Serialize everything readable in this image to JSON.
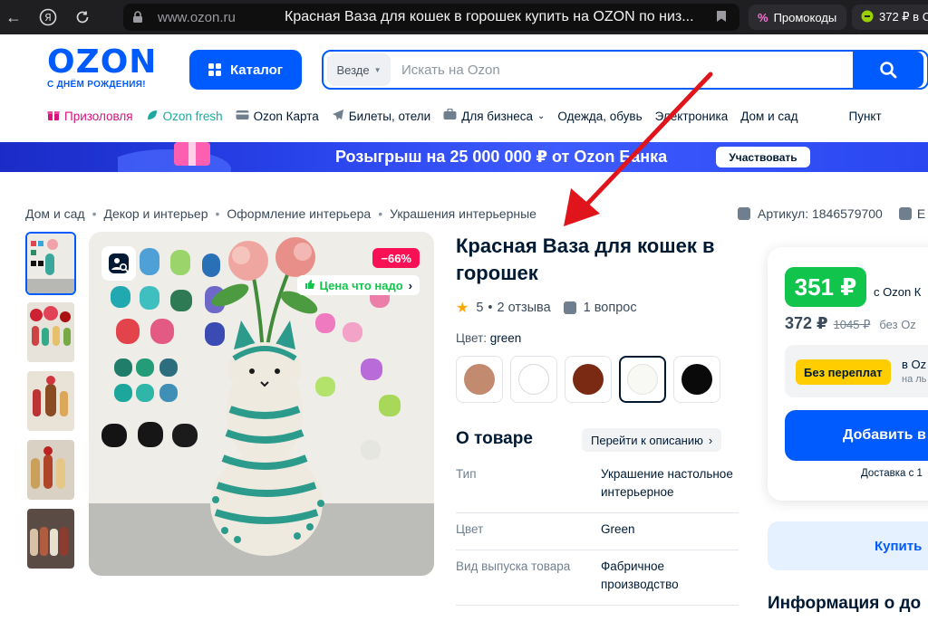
{
  "browser": {
    "domain": "www.ozon.ru",
    "tab_title": "Красная Ваза для кошек в горошек купить на OZON по низ...",
    "promo_chip": "Промокоды",
    "balance_chip": "372 ₽ в Ст",
    "icons": [
      "back-arrow-icon",
      "yandex-icon",
      "reload-icon",
      "lock-icon",
      "bookmark-icon"
    ]
  },
  "header": {
    "logo": "OZON",
    "logo_sub": "С ДНЁМ РОЖДЕНИЯ!",
    "catalog_label": "Каталог",
    "search_scope": "Везде",
    "search_placeholder": "Искать на Ozon"
  },
  "toplinks": [
    {
      "label": "Призоловля",
      "icon": "gift-icon",
      "color": "#d6127c"
    },
    {
      "label": "Ozon fresh",
      "icon": "leaf-icon",
      "color": "#1ba9a0"
    },
    {
      "label": "Ozon Карта",
      "icon": "card-icon",
      "color": "#001a34"
    },
    {
      "label": "Билеты, отели",
      "icon": "plane-icon",
      "color": "#001a34"
    },
    {
      "label": "Для бизнеса",
      "icon": "briefcase-icon",
      "color": "#001a34"
    },
    {
      "label": "Одежда, обувь",
      "icon": "",
      "color": "#001a34"
    },
    {
      "label": "Электроника",
      "icon": "",
      "color": "#001a34"
    },
    {
      "label": "Дом и сад",
      "icon": "",
      "color": "#001a34"
    },
    {
      "label": "Пункт",
      "icon": "",
      "color": "#001a34"
    }
  ],
  "banner": {
    "text": "Розыгрыш на 25 000 000 ₽ от Ozon Банка",
    "button": "Участвовать"
  },
  "breadcrumbs": [
    "Дом и сад",
    "Декор и интерьер",
    "Оформление интерьера",
    "Украшения интерьерные"
  ],
  "article": "Артикул: 1846579700",
  "article_tail": "Е",
  "product": {
    "title": "Красная Ваза для кошек в горошек",
    "discount_badge": "−66%",
    "price_badge": "Цена что надо",
    "rating": "5",
    "reviews": "2 отзыва",
    "questions": "1 вопрос",
    "color_label": "Цвет:",
    "color_value": "green",
    "swatches": [
      {
        "color": "#c28a6e",
        "selected": false
      },
      {
        "color": "#ffffff",
        "selected": false
      },
      {
        "color": "#7a2a12",
        "selected": false
      },
      {
        "color": "#f8f8f4",
        "selected": true
      },
      {
        "color": "#0a0a0a",
        "selected": false
      }
    ],
    "about_title": "О товаре",
    "about_link": "Перейти к описанию",
    "properties": [
      {
        "key": "Тип",
        "value": "Украшение настольное интерьерное"
      },
      {
        "key": "Цвет",
        "value": "Green"
      },
      {
        "key": "Вид выпуска товара",
        "value": "Фабричное производство"
      }
    ]
  },
  "price": {
    "main": "351 ₽",
    "with_label": "с Ozon К",
    "regular": "372 ₽",
    "old": "1045 ₽",
    "without_label": "без Oz",
    "promo_tag": "Без переплат",
    "promo_line1": "в Oz",
    "promo_line2": "на ль",
    "add_button": "Добавить в",
    "delivery": "Доставка с 1",
    "buy_button": "Купить",
    "info_title": "Информация о до"
  },
  "colors": {
    "brand": "#005bff",
    "discount": "#f91155",
    "price_green": "#10c44c",
    "promo_yellow": "#ffcd00",
    "annotation_arrow": "#e0151b"
  }
}
